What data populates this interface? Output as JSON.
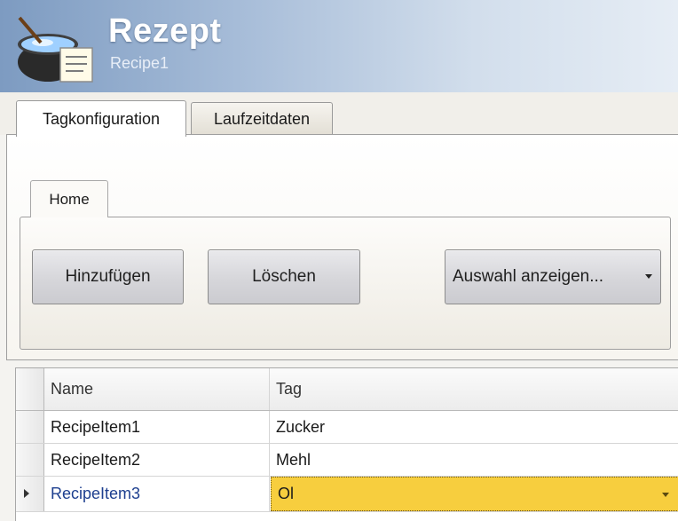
{
  "header": {
    "title": "Rezept",
    "subtitle": "Recipe1",
    "icon": "recipe-pot-icon"
  },
  "outer_tabs": [
    {
      "label": "Tagkonfiguration",
      "active": true
    },
    {
      "label": "Laufzeitdaten",
      "active": false
    }
  ],
  "ribbon": {
    "tab_label": "Home",
    "add_label": "Hinzufügen",
    "delete_label": "Löschen",
    "select_label": "Auswahl anzeigen..."
  },
  "grid": {
    "columns": [
      "Name",
      "Tag"
    ],
    "rows": [
      {
        "name": "RecipeItem1",
        "tag": "Zucker"
      },
      {
        "name": "RecipeItem2",
        "tag": "Mehl"
      },
      {
        "name": "RecipeItem3",
        "tag": "Ol"
      }
    ],
    "selected_row": 2,
    "selected_cell_color": "#f7ce3e"
  }
}
